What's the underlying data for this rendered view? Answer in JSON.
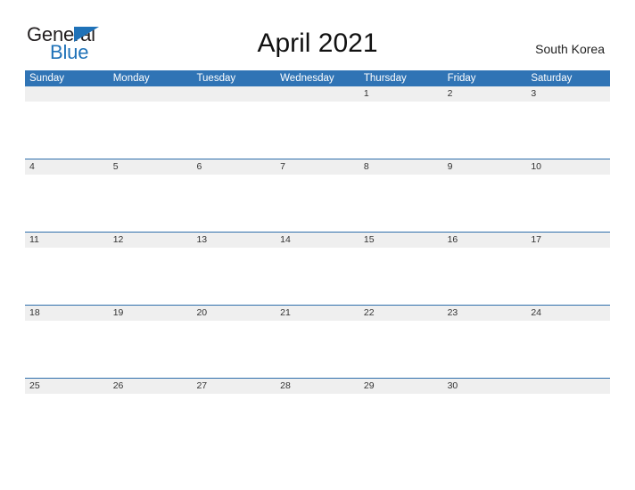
{
  "brand": {
    "name_part1": "General",
    "name_part2": "Blue",
    "flag_icon": "blue-triangle-flag",
    "colors": {
      "dark": "#231f20",
      "blue": "#1f72b8"
    }
  },
  "header": {
    "title": "April 2021",
    "region": "South Korea"
  },
  "calendar": {
    "month": "April",
    "year": "2021",
    "header_color": "#3074b5",
    "band_color": "#efefef",
    "divider_color": "#2f6fac",
    "weekdays": [
      "Sunday",
      "Monday",
      "Tuesday",
      "Wednesday",
      "Thursday",
      "Friday",
      "Saturday"
    ],
    "weeks": [
      {
        "days": [
          "",
          "",
          "",
          "",
          "1",
          "2",
          "3"
        ]
      },
      {
        "days": [
          "4",
          "5",
          "6",
          "7",
          "8",
          "9",
          "10"
        ]
      },
      {
        "days": [
          "11",
          "12",
          "13",
          "14",
          "15",
          "16",
          "17"
        ]
      },
      {
        "days": [
          "18",
          "19",
          "20",
          "21",
          "22",
          "23",
          "24"
        ]
      },
      {
        "days": [
          "25",
          "26",
          "27",
          "28",
          "29",
          "30",
          ""
        ]
      }
    ]
  }
}
